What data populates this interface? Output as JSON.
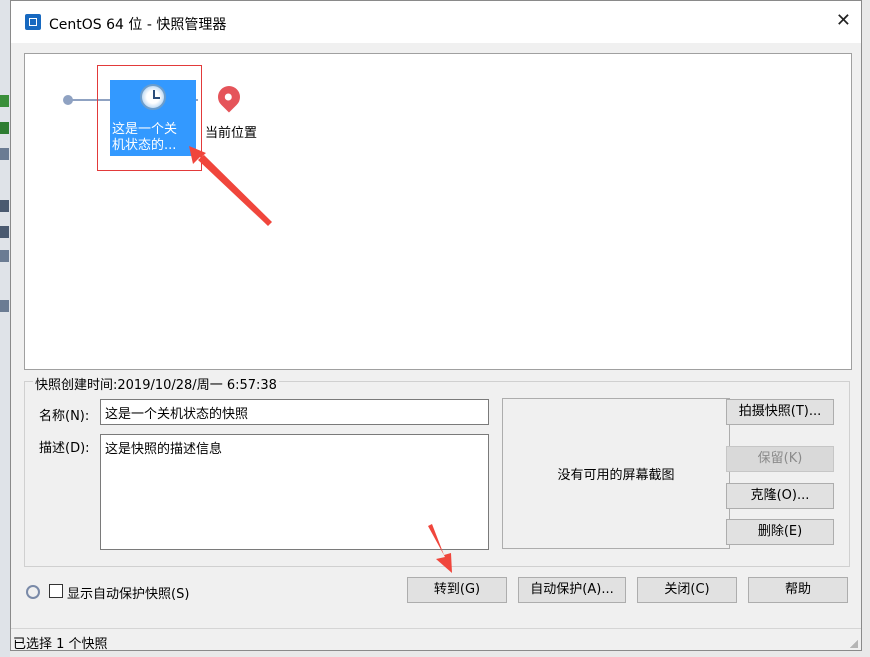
{
  "window": {
    "title": "CentOS 64 位 - 快照管理器",
    "close_glyph": "✕"
  },
  "tree": {
    "snapshot_name": "这是一个关\n机状态的...",
    "current_label": "当前位置"
  },
  "details": {
    "group_title": "快照创建时间:2019/10/28/周一 6:57:38",
    "name_label": "名称(N):",
    "name_value": "这是一个关机状态的快照",
    "desc_label": "描述(D):",
    "desc_value": "这是快照的描述信息",
    "preview_text": "没有可用的屏幕截图"
  },
  "side_buttons": {
    "take": "拍摄快照(T)...",
    "keep": "保留(K)",
    "clone": "克隆(O)...",
    "delete": "删除(E)"
  },
  "bottom": {
    "auto_show_label": "显示自动保护快照(S)",
    "goto": "转到(G)",
    "autoprotect": "自动保护(A)...",
    "close": "关闭(C)",
    "help": "帮助"
  },
  "status": {
    "text": "已选择 1 个快照"
  },
  "colors": {
    "selection": "#3399ff",
    "highlight_border": "#e23a3a",
    "pin": "#e5545a",
    "annotation_arrow": "#f0463c"
  }
}
